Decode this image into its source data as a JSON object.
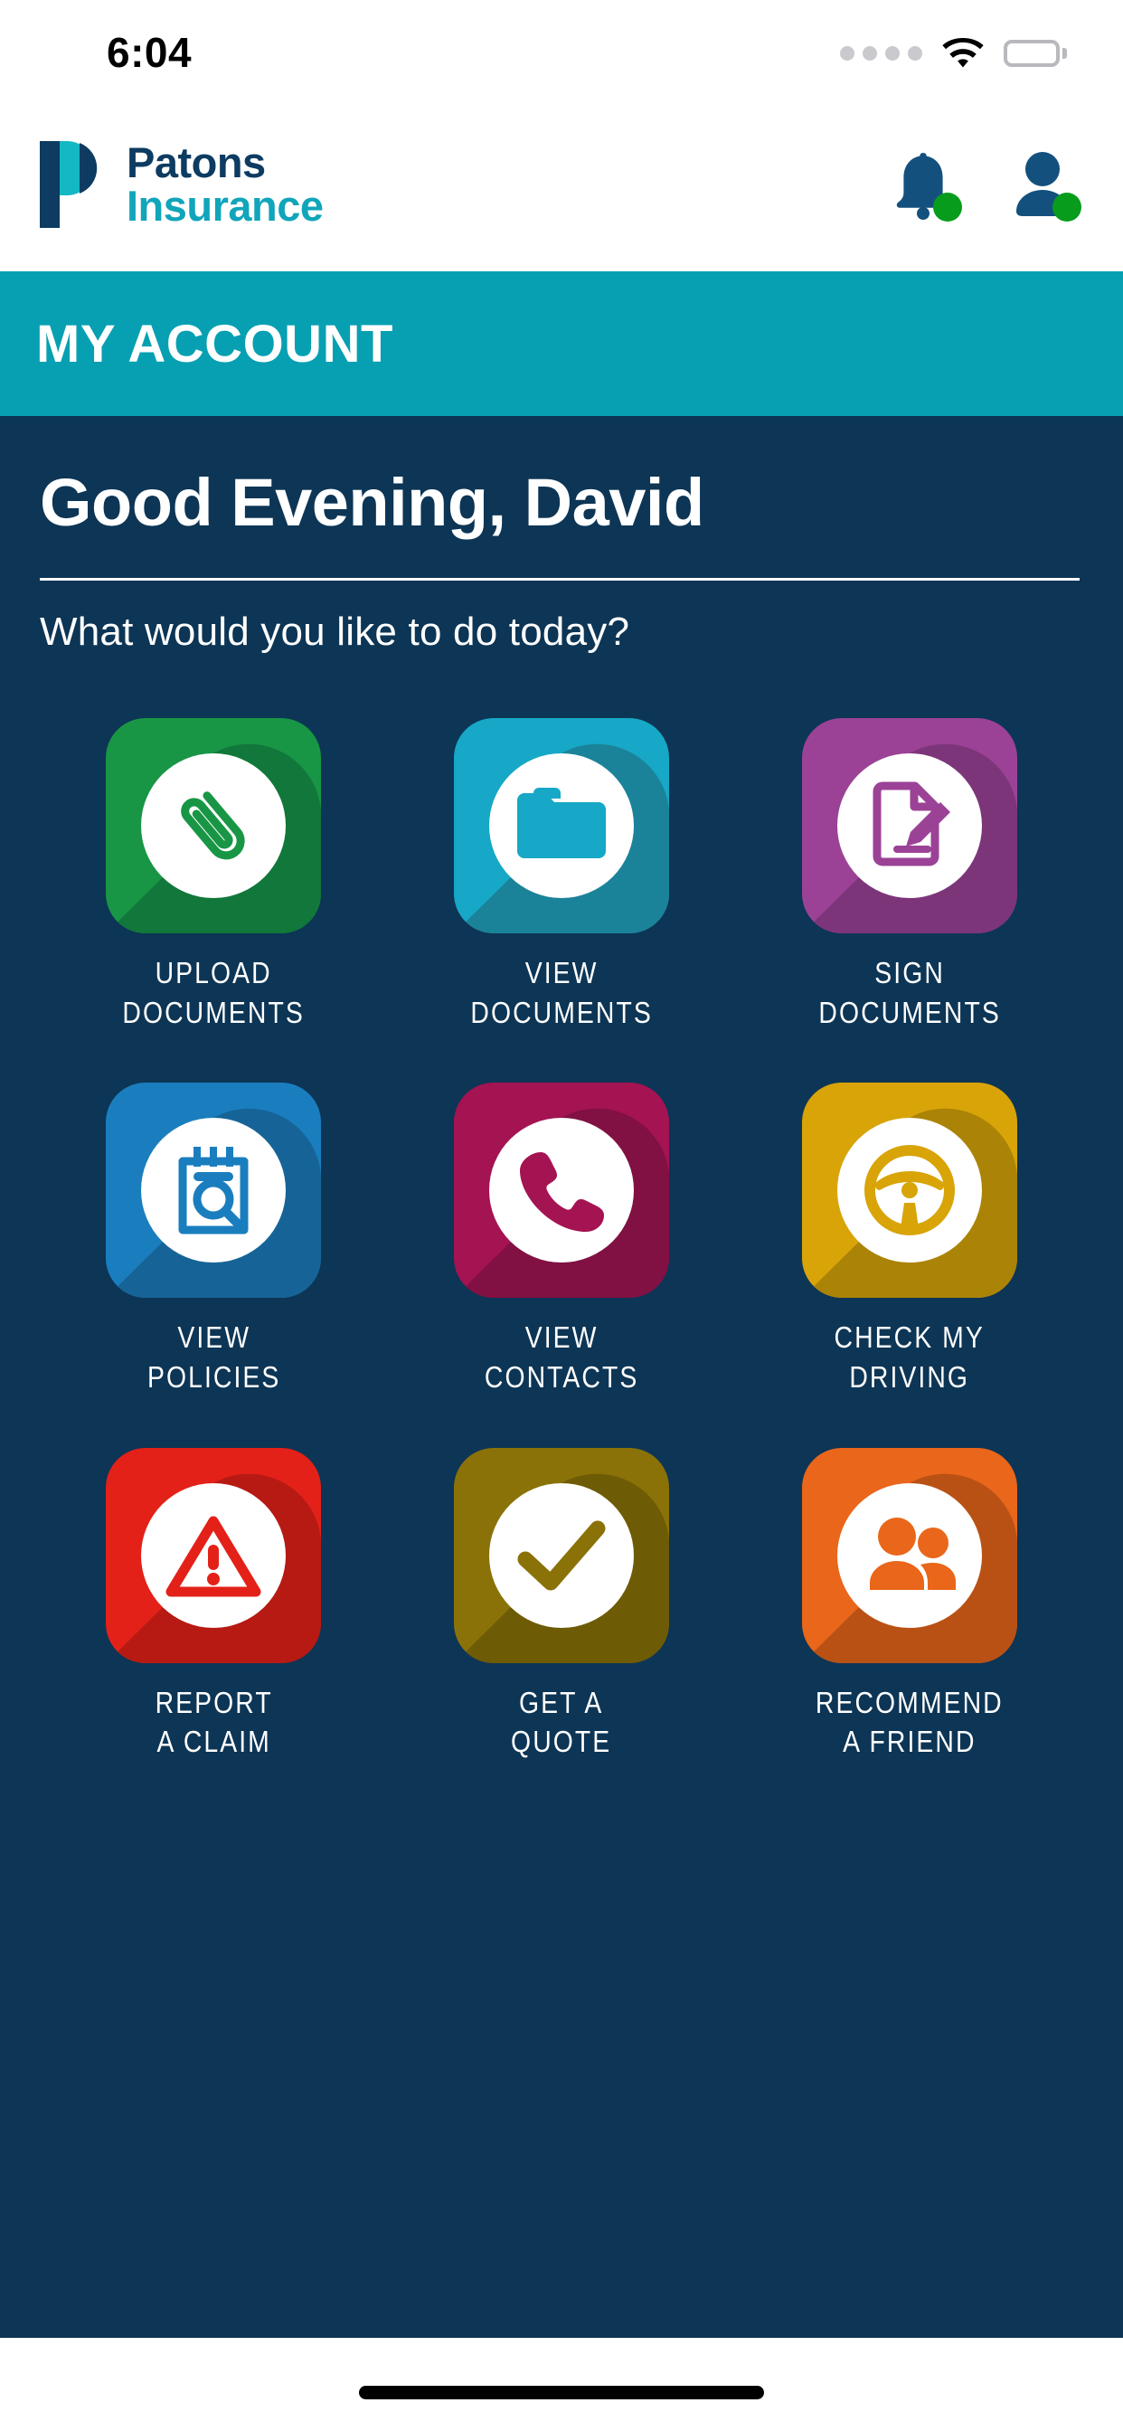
{
  "status_bar": {
    "time": "6:04",
    "signal_icon": "signal-dots-icon",
    "wifi_icon": "wifi-icon",
    "battery_icon": "battery-full-icon"
  },
  "header": {
    "brand_mark": "patons-p-logomark",
    "brand_line1": "Patons",
    "brand_line2": "Insurance",
    "notifications_icon": "bell-icon",
    "notifications_badge": "status-dot",
    "account_icon": "user-avatar-icon",
    "account_badge": "status-dot"
  },
  "page_bar": {
    "title": "MY ACCOUNT"
  },
  "main": {
    "greeting": "Good Evening, David",
    "subtitle": "What would you like to do today?",
    "tiles": [
      {
        "label": "UPLOAD\nDOCUMENTS",
        "icon": "paperclip-icon",
        "color": "#189645",
        "shadow": "#11773a"
      },
      {
        "label": "VIEW\nDOCUMENTS",
        "icon": "folder-icon",
        "color": "#16a8c6",
        "shadow": "#1b8399"
      },
      {
        "label": "SIGN\nDOCUMENTS",
        "icon": "document-pencil-icon",
        "color": "#9b4296",
        "shadow": "#7d3579"
      },
      {
        "label": "VIEW\nPOLICIES",
        "icon": "notepad-search-icon",
        "color": "#1a7ebe",
        "shadow": "#166497"
      },
      {
        "label": "VIEW\nCONTACTS",
        "icon": "phone-icon",
        "color": "#a41352",
        "shadow": "#811043"
      },
      {
        "label": "CHECK MY\nDRIVING",
        "icon": "steering-wheel-icon",
        "color": "#d8a408",
        "shadow": "#ab8306"
      },
      {
        "label": "REPORT\nA CLAIM",
        "icon": "warning-triangle-icon",
        "color": "#e32118",
        "shadow": "#b61a13"
      },
      {
        "label": "GET A\nQUOTE",
        "icon": "checkmark-icon",
        "color": "#8a7208",
        "shadow": "#6e5b06"
      },
      {
        "label": "RECOMMEND\nA FRIEND",
        "icon": "two-people-icon",
        "color": "#e9661a",
        "shadow": "#b95115"
      }
    ]
  },
  "home_indicator": {
    "label": "home-indicator"
  },
  "colors": {
    "brand_navy": "#0d3b61",
    "brand_teal": "#10a5ba",
    "banner_teal": "#07a0b2",
    "content_navy": "#0d3555",
    "badge_green": "#079c1c"
  }
}
